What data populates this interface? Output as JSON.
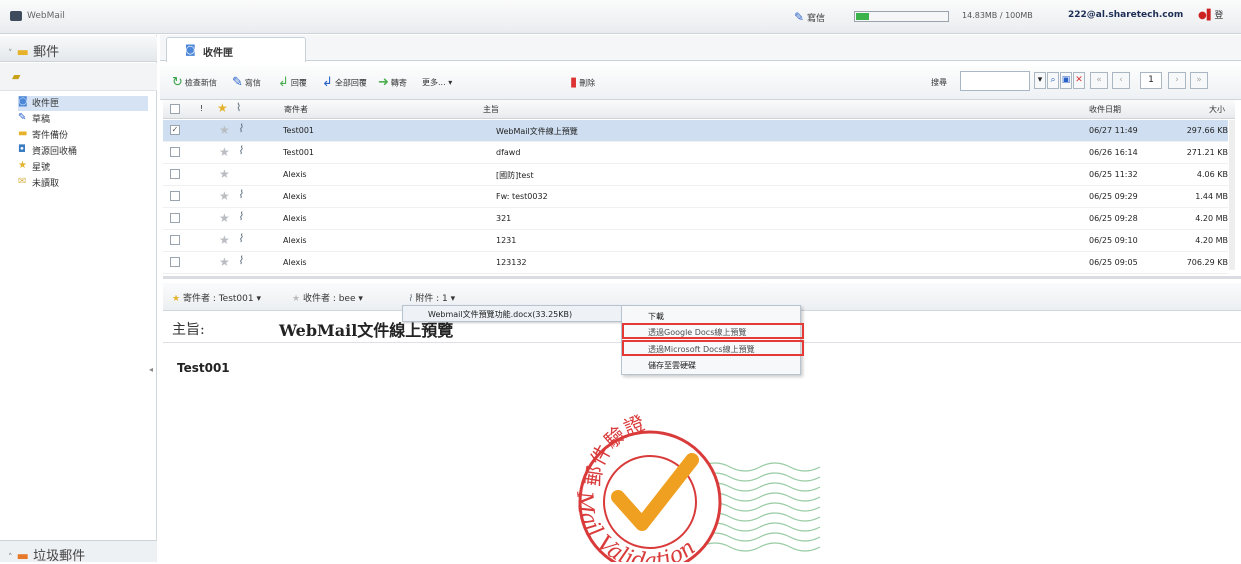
{
  "app": {
    "title": "WebMail"
  },
  "topbar": {
    "compose_label": "寫信",
    "quota_text": "14.83MB / 100MB",
    "quota_fraction": 0.148,
    "user_email": "222@al.sharetech.com",
    "logout_label": "登"
  },
  "sidebar": {
    "header": "郵件",
    "folders": [
      {
        "label": "收件匣",
        "icon": "inbox-icon"
      },
      {
        "label": "草稿",
        "icon": "draft-icon"
      },
      {
        "label": "寄件備份",
        "icon": "sent-icon"
      },
      {
        "label": "資源回收桶",
        "icon": "trash-icon"
      },
      {
        "label": "星號",
        "icon": "star-icon"
      },
      {
        "label": "未讀取",
        "icon": "unread-icon"
      }
    ],
    "junk_label": "垃圾郵件"
  },
  "tab": {
    "label": "收件匣"
  },
  "toolbar": {
    "check_mail": "檢查新信",
    "compose": "寫信",
    "reply": "回覆",
    "reply_all": "全部回覆",
    "forward": "轉寄",
    "more": "更多...",
    "delete": "刪除",
    "search_label": "搜尋",
    "page_value": "1"
  },
  "grid": {
    "headers": {
      "from": "寄件者",
      "subject": "主旨",
      "date": "收件日期",
      "size": "大小"
    },
    "rows": [
      {
        "from": "Test001",
        "subject": "WebMail文件線上預覽",
        "date": "06/27 11:49",
        "size": "297.66 KB",
        "checked": true,
        "attachment": true
      },
      {
        "from": "Test001",
        "subject": "dfawd",
        "date": "06/26 16:14",
        "size": "271.21 KB",
        "checked": false,
        "attachment": true
      },
      {
        "from": "Alexis",
        "subject": "[國防]test",
        "date": "06/25 11:32",
        "size": "4.06 KB",
        "checked": false,
        "attachment": false
      },
      {
        "from": "Alexis",
        "subject": "Fw: test0032",
        "date": "06/25 09:29",
        "size": "1.44 MB",
        "checked": false,
        "attachment": true
      },
      {
        "from": "Alexis",
        "subject": "321",
        "date": "06/25 09:28",
        "size": "4.20 MB",
        "checked": false,
        "attachment": true
      },
      {
        "from": "Alexis",
        "subject": "1231",
        "date": "06/25 09:10",
        "size": "4.20 MB",
        "checked": false,
        "attachment": true
      },
      {
        "from": "Alexis",
        "subject": "123132",
        "date": "06/25 09:05",
        "size": "706.29 KB",
        "checked": false,
        "attachment": true
      }
    ]
  },
  "reading": {
    "sender_chip": "寄件者 : Test001",
    "recipient_chip": "收件者 : bee",
    "attachment_chip": "附件 : 1",
    "subject_label": "主旨:",
    "subject_value": "WebMail文件線上預覽",
    "body": "Test001",
    "stamp_top": "郵件驗證",
    "stamp_bottom": "Mail Validation"
  },
  "attachment_menu": {
    "file": "Webmail文件預覽功能.docx(33.25KB)",
    "items": [
      "下載",
      "透過Google Docs線上預覽",
      "透過Microsoft Docs線上預覽",
      "儲存至雲硬碟"
    ]
  }
}
